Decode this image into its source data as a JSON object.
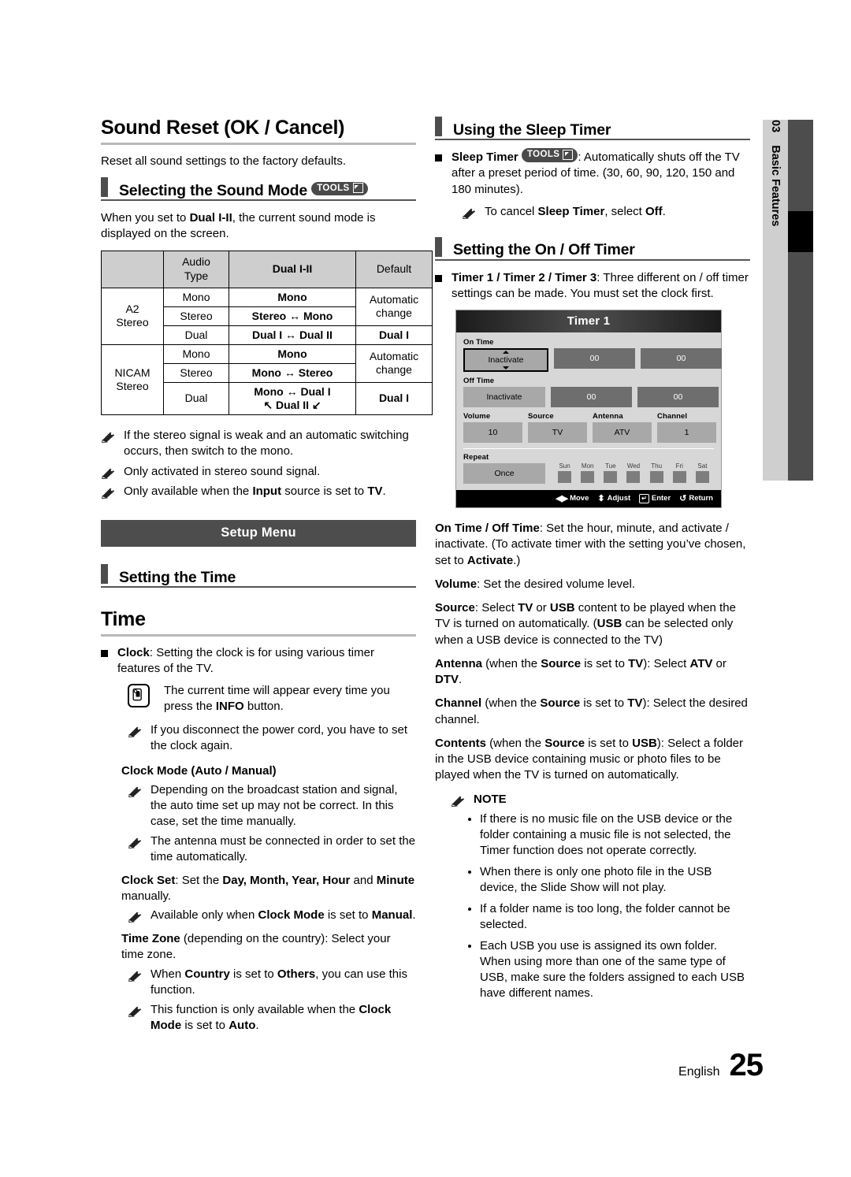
{
  "left": {
    "title": "Sound Reset (OK / Cancel)",
    "intro": "Reset all sound settings to the factory defaults.",
    "section_sound_mode": "Selecting the Sound Mode",
    "tools_label": "TOOLS",
    "sound_mode_desc_1": "When you set to ",
    "sound_mode_desc_bold": "Dual I-II",
    "sound_mode_desc_2": ", the current sound mode is displayed on the screen.",
    "table": {
      "headers": [
        "",
        "Audio Type",
        "Dual I-II",
        "Default"
      ],
      "header_audio_line1": "Audio",
      "header_audio_line2": "Type",
      "header_dual": "Dual I-II",
      "header_default": "Default",
      "rows": [
        {
          "group": "A2 Stereo",
          "group_line1": "A2",
          "group_line2": "Stereo",
          "type": "Mono",
          "dual": "Mono",
          "default": "Automatic change",
          "default_line1": "Automatic",
          "default_line2": "change"
        },
        {
          "type": "Stereo",
          "dual": "Stereo ↔ Mono"
        },
        {
          "type": "Dual",
          "dual": "Dual I ↔ Dual II",
          "default": "Dual I"
        },
        {
          "group": "NICAM Stereo",
          "group_line1": "NICAM",
          "group_line2": "Stereo",
          "type": "Mono",
          "dual": "Mono",
          "default": "Automatic change",
          "default_line1": "Automatic",
          "default_line2": "change"
        },
        {
          "type": "Stereo",
          "dual": "Mono ↔ Stereo"
        },
        {
          "type": "Dual",
          "dual": "Mono ↔ Dual I",
          "dual_line2": "↖ Dual II ↙",
          "default": "Dual I"
        }
      ]
    },
    "notes": [
      "If the stereo signal is weak and an automatic switching occurs, then switch to the mono.",
      "Only activated in stereo sound signal.",
      "Only available when the Input source is set to TV."
    ],
    "note3_pre": "Only available when the ",
    "note3_b1": "Input",
    "note3_mid": " source is set to ",
    "note3_b2": "TV",
    "note3_end": ".",
    "setup_menu_banner": "Setup Menu",
    "section_setting_time": "Setting the Time",
    "time_title": "Time",
    "clock_label": "Clock",
    "clock_desc": ": Setting the clock is for using various timer features of the TV.",
    "info_note_pre": "The current time will appear every time you press the ",
    "info_note_b": "INFO",
    "info_note_post": " button.",
    "power_note": "If you disconnect the power cord, you have to set the clock again.",
    "clock_mode_head": "Clock Mode (Auto / Manual)",
    "clock_mode_note1": "Depending on the broadcast station and signal, the auto time set up may not be correct. In this case, set the time manually.",
    "clock_mode_note2": "The antenna must be connected in order to set the time automatically.",
    "clock_set_b": "Clock Set",
    "clock_set_pre": ": Set the ",
    "clock_set_fields": "Day, Month, Year, Hour",
    "clock_set_mid": " and ",
    "clock_set_last": "Minute",
    "clock_set_post": " manually.",
    "clock_set_note_pre": "Available only when ",
    "clock_set_note_b1": "Clock Mode",
    "clock_set_note_mid": " is set to ",
    "clock_set_note_b2": "Manual",
    "clock_set_note_end": ".",
    "timezone_b": "Time Zone",
    "timezone_desc": " (depending on the country): Select your time zone.",
    "timezone_note1_pre": "When ",
    "timezone_note1_b1": "Country",
    "timezone_note1_mid": " is set to ",
    "timezone_note1_b2": "Others",
    "timezone_note1_end": ", you can use this function.",
    "timezone_note2_pre": "This function is only available when the ",
    "timezone_note2_b1": "Clock Mode",
    "timezone_note2_mid": " is set to ",
    "timezone_note2_b2": "Auto",
    "timezone_note2_end": "."
  },
  "right": {
    "section_sleep_timer": "Using the Sleep Timer",
    "sleep_timer_b": "Sleep Timer",
    "tools_label": "TOOLS",
    "sleep_timer_desc": ": Automatically shuts off the TV after a preset period of time. (30, 60, 90, 120, 150 and 180 minutes).",
    "sleep_cancel_pre": "To cancel ",
    "sleep_cancel_b1": "Sleep Timer",
    "sleep_cancel_mid": ", select ",
    "sleep_cancel_b2": "Off",
    "sleep_cancel_end": ".",
    "section_onoff_timer": "Setting the On / Off Timer",
    "timer_b": "Timer 1 / Timer 2 / Timer 3",
    "timer_desc": ": Three different on / off timer settings can be made. You must set the clock first.",
    "ontime_b": "On Time / Off Time",
    "ontime_desc_1": ": Set the hour, minute, and activate / inactivate. (To activate timer with the setting you’ve chosen, set to ",
    "ontime_b2": "Activate",
    "ontime_desc_2": ".)",
    "volume_b": "Volume",
    "volume_desc": ": Set the desired volume level.",
    "source_b": "Source",
    "source_desc_1": ": Select ",
    "source_b2": "TV",
    "source_desc_2": " or ",
    "source_b3": "USB",
    "source_desc_3": " content to be played when the TV is turned on automatically. (",
    "source_b4": "USB",
    "source_desc_4": " can be selected only when a USB device is connected to the TV)",
    "antenna_b": "Antenna",
    "antenna_desc_1": " (when the ",
    "antenna_b2": "Source",
    "antenna_desc_2": " is set to ",
    "antenna_b3": "TV",
    "antenna_desc_3": "): Select ",
    "antenna_b4": "ATV",
    "antenna_desc_4": " or ",
    "antenna_b5": "DTV",
    "antenna_desc_5": ".",
    "channel_b": "Channel",
    "channel_desc_1": " (when the ",
    "channel_b2": "Source",
    "channel_desc_2": " is set to ",
    "channel_b3": "TV",
    "channel_desc_3": "): Select the desired channel.",
    "contents_b": "Contents",
    "contents_desc_1": " (when the ",
    "contents_b2": "Source",
    "contents_desc_2": " is set to ",
    "contents_b3": "USB",
    "contents_desc_3": "): Select a folder in the USB device containing music or photo files to be played when the TV is turned on automatically.",
    "note_head": "NOTE",
    "bullets": [
      "If there is no music file on the USB device or the folder containing a music file is not selected, the Timer function does not operate correctly.",
      "When there is only one photo file in the USB device, the Slide Show will not play.",
      "If a folder name is too long, the folder cannot be selected.",
      "Each USB you use is assigned its own folder. When using more than one of the same type of USB, make sure the folders assigned to each USB have different names."
    ]
  },
  "osd": {
    "title": "Timer 1",
    "on_time_label": "On Time",
    "on_time_mode": "Inactivate",
    "on_time_hour": "00",
    "on_time_minute": "00",
    "off_time_label": "Off Time",
    "off_time_mode": "Inactivate",
    "off_time_hour": "00",
    "off_time_minute": "00",
    "volume_label": "Volume",
    "volume_value": "10",
    "source_label": "Source",
    "source_value": "TV",
    "antenna_label": "Antenna",
    "antenna_value": "ATV",
    "channel_label": "Channel",
    "channel_value": "1",
    "repeat_label": "Repeat",
    "repeat_value": "Once",
    "days": [
      "Sun",
      "Mon",
      "Tue",
      "Wed",
      "Thu",
      "Fri",
      "Sat"
    ],
    "footer": {
      "move": "Move",
      "adjust": "Adjust",
      "enter": "Enter",
      "return": "Return"
    }
  },
  "side_tab": {
    "number": "03",
    "label": "Basic Features"
  },
  "footer": {
    "language": "English",
    "page": "25"
  },
  "colors": {
    "dark_bar": "#4d4d4d",
    "table_header": "#cecece",
    "side_tab_light": "#cfcfcf",
    "osd_bg": "#d7d7d7",
    "osd_field": "#a8a8a8",
    "osd_field_dark": "#6e6e6e"
  }
}
